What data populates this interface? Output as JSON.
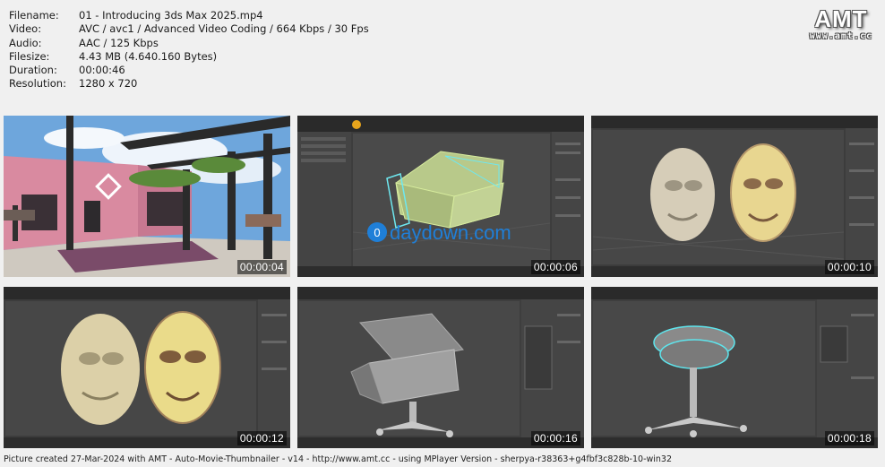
{
  "info": [
    {
      "label": "Filename:",
      "value": "01 - Introducing 3ds Max 2025.mp4"
    },
    {
      "label": "Video:",
      "value": "AVC / avc1 / Advanced Video Coding / 664 Kbps / 30 Fps"
    },
    {
      "label": "Audio:",
      "value": "AAC / 125 Kbps"
    },
    {
      "label": "Filesize:",
      "value": "4.43 MB (4.640.160 Bytes)"
    },
    {
      "label": "Duration:",
      "value": "00:00:46"
    },
    {
      "label": "Resolution:",
      "value": "1280 x 720"
    }
  ],
  "logo": {
    "title": "AMT",
    "url": "www.amt.cc"
  },
  "thumbnails": [
    {
      "timestamp": "00:00:04"
    },
    {
      "timestamp": "00:00:06",
      "watermark": "daydown.com"
    },
    {
      "timestamp": "00:00:10"
    },
    {
      "timestamp": "00:00:12"
    },
    {
      "timestamp": "00:00:16"
    },
    {
      "timestamp": "00:00:18"
    }
  ],
  "footer": "Picture created 27-Mar-2024 with AMT - Auto-Movie-Thumbnailer - v14 - http://www.amt.cc - using MPlayer Version - sherpya-r38363+g4fbf3c828b-10-win32"
}
